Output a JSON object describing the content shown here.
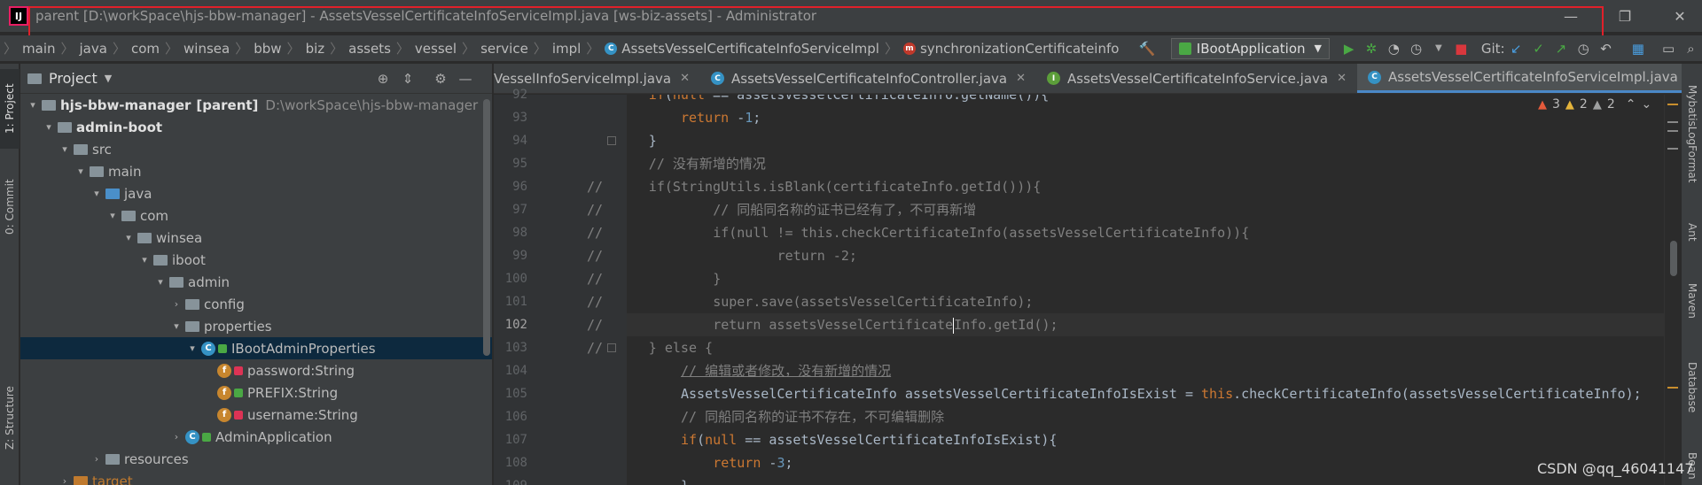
{
  "window": {
    "title": "parent [D:\\workSpace\\hjs-bbw-manager] - AssetsVesselCertificateInfoServiceImpl.java [ws-biz-assets] - Administrator",
    "app_icon": "IJ"
  },
  "navbar": {
    "crumbs": [
      "main",
      "java",
      "com",
      "winsea",
      "bbw",
      "biz",
      "assets",
      "vessel",
      "service",
      "impl",
      "AssetsVesselCertificateInfoServiceImpl",
      "synchronizationCertificateinfo"
    ],
    "run_config": "IBootApplication",
    "git_label": "Git:"
  },
  "left_tabs": [
    "1: Project",
    "0: Commit",
    "Z: Structure"
  ],
  "project": {
    "title": "Project",
    "tree": [
      {
        "depth": 0,
        "arrow": "▾",
        "icon": "folder",
        "label": "hjs-bbw-manager",
        "suffix": "[parent]",
        "path": "D:\\workSpace\\hjs-bbw-manager"
      },
      {
        "depth": 1,
        "arrow": "▾",
        "icon": "folder",
        "label": "admin-boot"
      },
      {
        "depth": 2,
        "arrow": "▾",
        "icon": "folder",
        "label": "src"
      },
      {
        "depth": 3,
        "arrow": "▾",
        "icon": "folder",
        "label": "main"
      },
      {
        "depth": 4,
        "arrow": "▾",
        "icon": "folder-blue",
        "label": "java"
      },
      {
        "depth": 5,
        "arrow": "▾",
        "icon": "folder",
        "label": "com"
      },
      {
        "depth": 6,
        "arrow": "▾",
        "icon": "folder",
        "label": "winsea"
      },
      {
        "depth": 7,
        "arrow": "▾",
        "icon": "folder",
        "label": "iboot"
      },
      {
        "depth": 8,
        "arrow": "▾",
        "icon": "folder",
        "label": "admin"
      },
      {
        "depth": 9,
        "arrow": "›",
        "icon": "folder",
        "label": "config"
      },
      {
        "depth": 9,
        "arrow": "▾",
        "icon": "folder",
        "label": "properties"
      },
      {
        "depth": 10,
        "arrow": "▾",
        "icon": "class",
        "label": "IBootAdminProperties",
        "selected": true
      },
      {
        "depth": 11,
        "arrow": "",
        "icon": "field",
        "label": "password:String"
      },
      {
        "depth": 11,
        "arrow": "",
        "icon": "field",
        "label": "PREFIX:String"
      },
      {
        "depth": 11,
        "arrow": "",
        "icon": "field",
        "label": "username:String"
      },
      {
        "depth": 9,
        "arrow": "›",
        "icon": "class",
        "label": "AdminApplication"
      },
      {
        "depth": 4,
        "arrow": "›",
        "icon": "folder",
        "label": "resources"
      },
      {
        "depth": 2,
        "arrow": "›",
        "icon": "folder-orange",
        "label": "target"
      }
    ]
  },
  "editor_tabs": [
    {
      "label": "VesselInfoServiceImpl.java",
      "icon": "C",
      "color": "#3592c4"
    },
    {
      "label": "AssetsVesselCertificateInfoController.java",
      "icon": "C",
      "color": "#3592c4"
    },
    {
      "label": "AssetsVesselCertificateInfoService.java",
      "icon": "I",
      "color": "#5c9e3a"
    },
    {
      "label": "AssetsVesselCertificateInfoServiceImpl.java",
      "icon": "C",
      "color": "#3592c4",
      "active": true
    }
  ],
  "inspections": {
    "errors": "3",
    "warnings": "2",
    "weak": "2"
  },
  "code": {
    "lines": [
      {
        "n": "92",
        "commented": false,
        "indent": 4,
        "html": "<span class=\"kw\">if</span>(<span class=\"kw\">null</span> == assetsVesselCertificateInfo.getName()){"
      },
      {
        "n": "93",
        "commented": false,
        "indent": 5,
        "html": "<span class=\"kw\">return</span> -<span class=\"num\">1</span>;"
      },
      {
        "n": "94",
        "commented": false,
        "indent": 4,
        "html": "}"
      },
      {
        "n": "95",
        "commented": false,
        "indent": 4,
        "html": "<span class=\"cm\">// 没有新增的情况</span>"
      },
      {
        "n": "96",
        "commented": true,
        "indent": 4,
        "html": "if(StringUtils.isBlank(certificateInfo.getId())){"
      },
      {
        "n": "97",
        "commented": true,
        "indent": 6,
        "html": "<span class=\"cm\">// 同船同名称的证书已经有了，不可再新增</span>"
      },
      {
        "n": "98",
        "commented": true,
        "indent": 6,
        "html": "if(null != this.checkCertificateInfo(assetsVesselCertificateInfo)){"
      },
      {
        "n": "99",
        "commented": true,
        "indent": 8,
        "html": "return -2;"
      },
      {
        "n": "100",
        "commented": true,
        "indent": 6,
        "html": "}"
      },
      {
        "n": "101",
        "commented": true,
        "indent": 6,
        "html": "super.save(assetsVesselCertificateInfo);"
      },
      {
        "n": "102",
        "commented": true,
        "indent": 6,
        "html": "return assetsVesselCertificate<span class=\"caret\"></span>Info.getId();",
        "current": true
      },
      {
        "n": "103",
        "commented": true,
        "indent": 4,
        "html": "} else {"
      },
      {
        "n": "104",
        "commented": false,
        "indent": 5,
        "html": "<span class=\"cm-u\">// 编辑或者修改，没有新增的情况</span>"
      },
      {
        "n": "105",
        "commented": false,
        "indent": 5,
        "html": "AssetsVesselCertificateInfo assetsVesselCertificateInfoIsExist = <span class=\"kw\">this</span>.checkCertificateInfo(assetsVesselCertificateInfo);"
      },
      {
        "n": "106",
        "commented": false,
        "indent": 5,
        "html": "<span class=\"cm\">// 同船同名称的证书不存在，不可编辑删除</span>"
      },
      {
        "n": "107",
        "commented": false,
        "indent": 5,
        "html": "<span class=\"kw\">if</span>(<span class=\"kw\">null</span> == assetsVesselCertificateInfoIsExist){"
      },
      {
        "n": "108",
        "commented": false,
        "indent": 6,
        "html": "<span class=\"kw\">return</span> -<span class=\"num\">3</span>;"
      },
      {
        "n": "109",
        "commented": false,
        "indent": 5,
        "html": "}"
      }
    ]
  },
  "right_tabs": [
    "MybatisLogFormat",
    "Ant",
    "Maven",
    "Database",
    "Bean"
  ],
  "watermark": "CSDN @qq_46041147"
}
